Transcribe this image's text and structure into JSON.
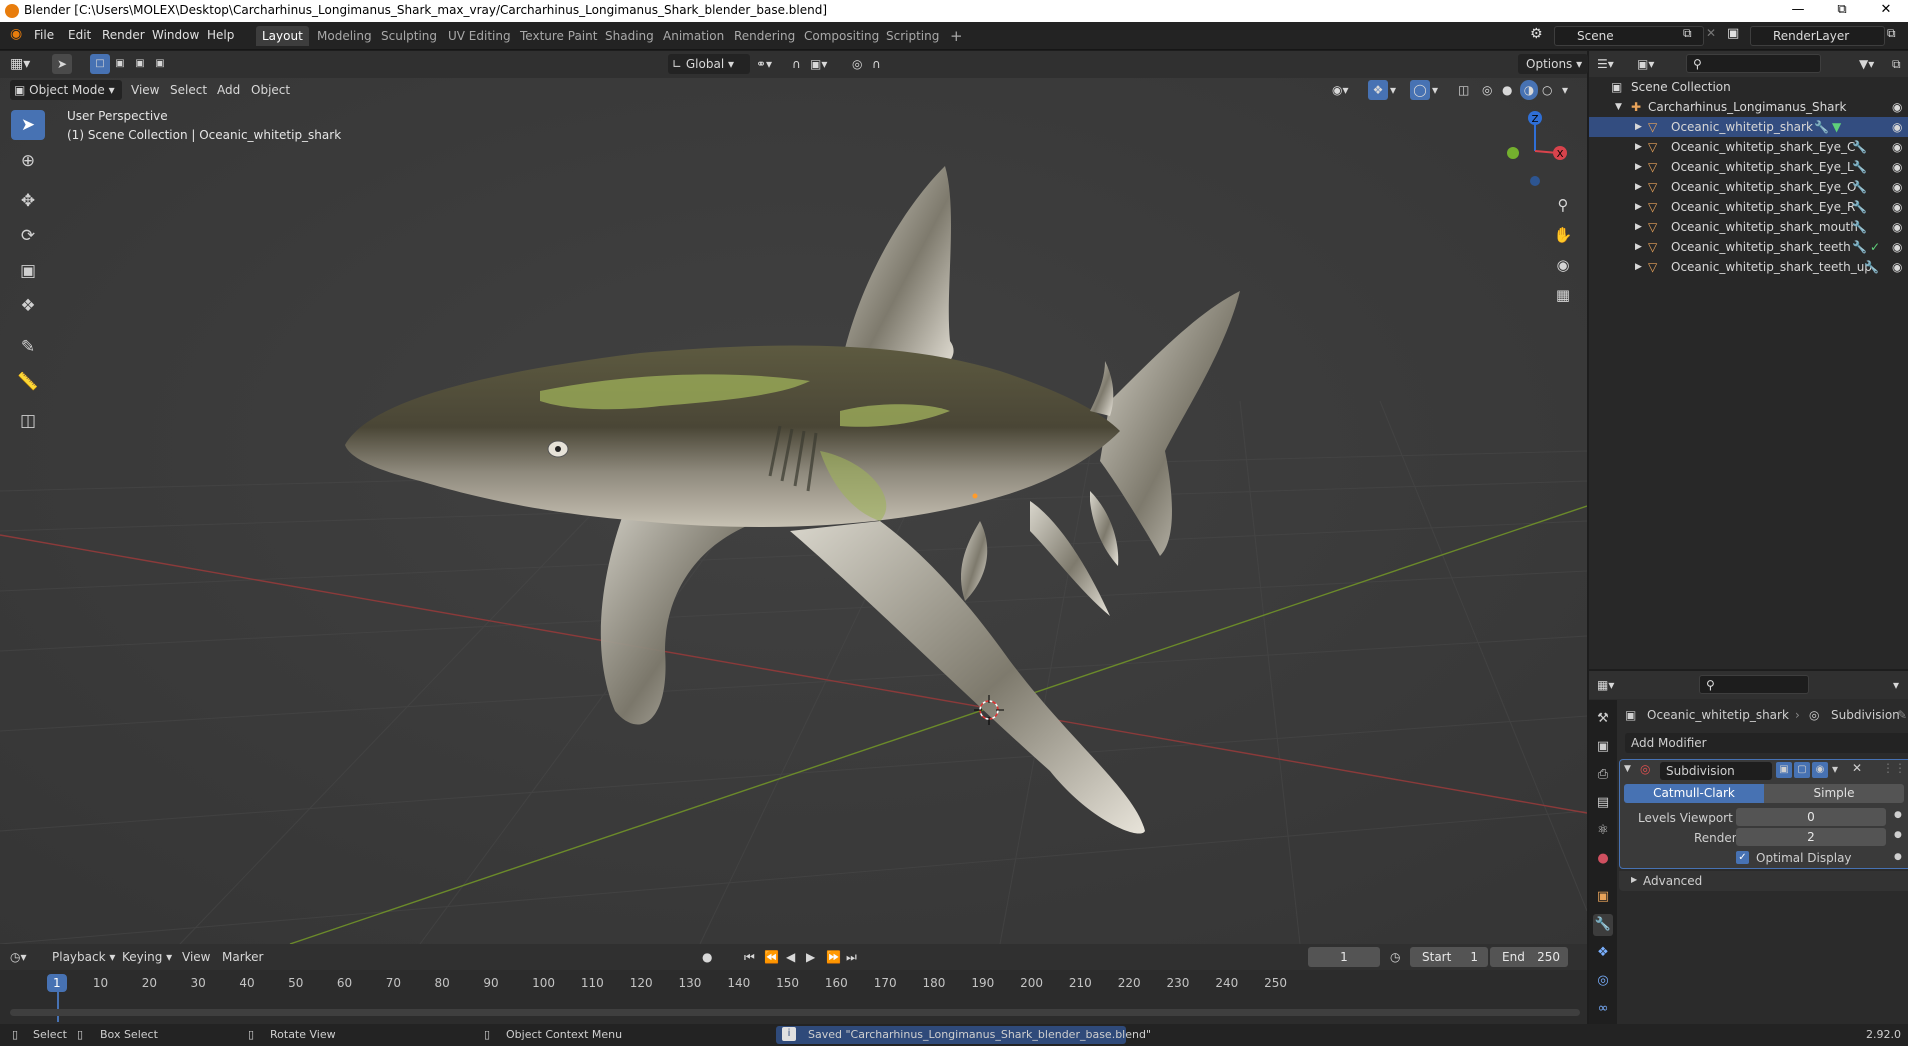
{
  "window": {
    "title": "Blender [C:\\Users\\MOLEX\\Desktop\\Carcharhinus_Longimanus_Shark_max_vray/Carcharhinus_Longimanus_Shark_blender_base.blend]"
  },
  "menu": {
    "file": "File",
    "edit": "Edit",
    "render": "Render",
    "window": "Window",
    "help": "Help"
  },
  "workspaces": [
    "Layout",
    "Modeling",
    "Sculpting",
    "UV Editing",
    "Texture Paint",
    "Shading",
    "Animation",
    "Rendering",
    "Compositing",
    "Scripting"
  ],
  "scene": {
    "scene_name": "Scene",
    "view_layer": "RenderLayer"
  },
  "viewport": {
    "mode": "Object Mode",
    "menu_view": "View",
    "menu_select": "Select",
    "menu_add": "Add",
    "menu_object": "Object",
    "transform_orientation": "Global",
    "options": "Options",
    "overlay_title": "User Perspective",
    "overlay_collection": "(1) Scene Collection | Oceanic_whitetip_shark",
    "gizmo_x": "X",
    "gizmo_y": "Y",
    "gizmo_z": "Z"
  },
  "outliner": {
    "root": "Scene Collection",
    "collection": "Carcharhinus_Longimanus_Shark",
    "objects": [
      "Oceanic_whitetip_shark",
      "Oceanic_whitetip_shark_Eye_C",
      "Oceanic_whitetip_shark_Eye_L",
      "Oceanic_whitetip_shark_Eye_O",
      "Oceanic_whitetip_shark_Eye_R",
      "Oceanic_whitetip_shark_mouth",
      "Oceanic_whitetip_shark_teeth",
      "Oceanic_whitetip_shark_teeth_up"
    ]
  },
  "properties": {
    "object_name": "Oceanic_whitetip_shark",
    "modifier_breadcrumb": "Subdivision",
    "add_modifier": "Add Modifier",
    "modifier_name": "Subdivision",
    "catmull": "Catmull-Clark",
    "simple": "Simple",
    "levels_viewport_label": "Levels Viewport",
    "levels_viewport_value": "0",
    "render_label": "Render",
    "render_value": "2",
    "optimal_display": "Optimal Display",
    "advanced": "Advanced"
  },
  "timeline": {
    "playback": "Playback",
    "keying": "Keying",
    "view": "View",
    "marker": "Marker",
    "current_frame": "1",
    "start_label": "Start",
    "start_value": "1",
    "end_label": "End",
    "end_value": "250",
    "ticks": [
      "1",
      "10",
      "20",
      "30",
      "40",
      "50",
      "60",
      "70",
      "80",
      "90",
      "100",
      "110",
      "120",
      "130",
      "140",
      "150",
      "160",
      "170",
      "180",
      "190",
      "200",
      "210",
      "220",
      "230",
      "240",
      "250"
    ]
  },
  "status": {
    "select": "Select",
    "box_select": "Box Select",
    "rotate_view": "Rotate View",
    "context_menu": "Object Context Menu",
    "message": "Saved \"Carcharhinus_Longimanus_Shark_blender_base.blend\"",
    "version": "2.92.0"
  },
  "colors": {
    "accent": "#4772b3",
    "selected_row": "#334d80",
    "active_modifier": "#4772b3"
  }
}
